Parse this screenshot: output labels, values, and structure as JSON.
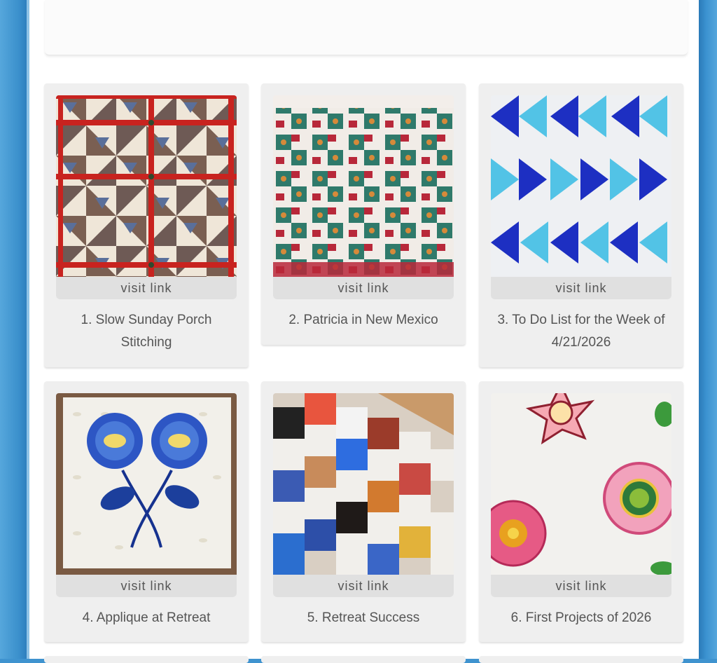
{
  "gallery": {
    "link_label": "visit link",
    "items": [
      {
        "caption": "1. Slow Sunday Porch Stitching",
        "image": "red-sashed-pinwheel-quilt"
      },
      {
        "caption": "2. Patricia in New Mexico",
        "image": "green-red-step-quilt"
      },
      {
        "caption": "3. To Do List for the Week of 4/21/2026",
        "image": "blue-flying-geese-quilt"
      },
      {
        "caption": "4. Applique at Retreat",
        "image": "blue-flower-applique-block"
      },
      {
        "caption": "5. Retreat Success",
        "image": "novelty-print-patchwork-quilt"
      },
      {
        "caption": "6. First Projects of 2026",
        "image": "raw-edge-flower-applique"
      }
    ]
  },
  "colors": {
    "frame_blue": "#3f93cf",
    "card_bg": "#efefef",
    "link_bg": "#e0e0e0",
    "text": "#555555"
  }
}
